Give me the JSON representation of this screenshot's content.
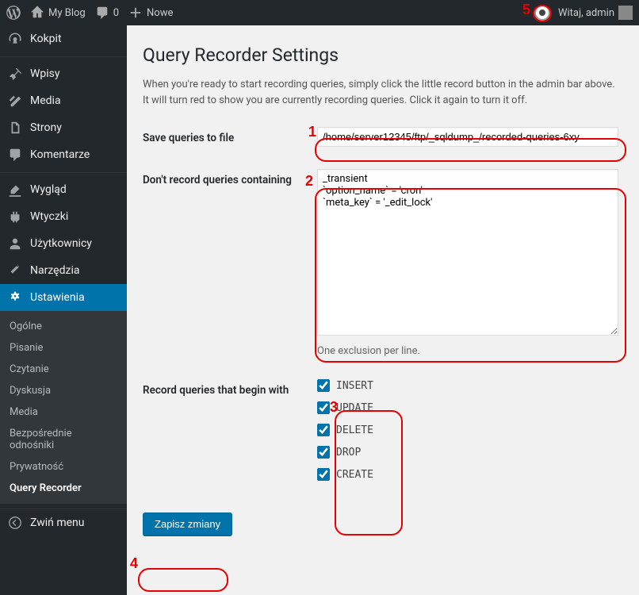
{
  "adminbar": {
    "site_title": "My Blog",
    "comments_count": "0",
    "new_label": "Nowe",
    "howdy": "Witaj, admin"
  },
  "menu": {
    "dashboard": "Kokpit",
    "posts": "Wpisy",
    "media": "Media",
    "pages": "Strony",
    "comments": "Komentarze",
    "appearance": "Wygląd",
    "plugins": "Wtyczki",
    "users": "Użytkownicy",
    "tools": "Narzędzia",
    "settings": "Ustawienia",
    "collapse": "Zwiń menu"
  },
  "submenu": {
    "general": "Ogólne",
    "writing": "Pisanie",
    "reading": "Czytanie",
    "discussion": "Dyskusja",
    "media": "Media",
    "permalinks": "Bezpośrednie odnośniki",
    "privacy": "Prywatność",
    "query_recorder": "Query Recorder"
  },
  "page": {
    "title": "Query Recorder Settings",
    "description": "When you're ready to start recording queries, simply click the little record button in the admin bar above. It will turn red to show you are currently recording queries. Click it again to turn it off.",
    "label_save": "Save queries to file",
    "value_save": "/home/server12345/ftp/_sqldump_/recorded-queries-6xy",
    "label_exclude": "Don't record queries containing",
    "value_exclude": "_transient\n`option_name` = 'cron'\n`meta_key` = '_edit_lock'",
    "hint_exclude": "One exclusion per line.",
    "label_begin": "Record queries that begin with",
    "submit": "Zapisz zmiany"
  },
  "checks": {
    "insert": "INSERT",
    "update": "UPDATE",
    "delete": "DELETE",
    "drop": "DROP",
    "create": "CREATE"
  },
  "annotations": {
    "n1": "1",
    "n2": "2",
    "n3": "3",
    "n4": "4",
    "n5": "5"
  }
}
